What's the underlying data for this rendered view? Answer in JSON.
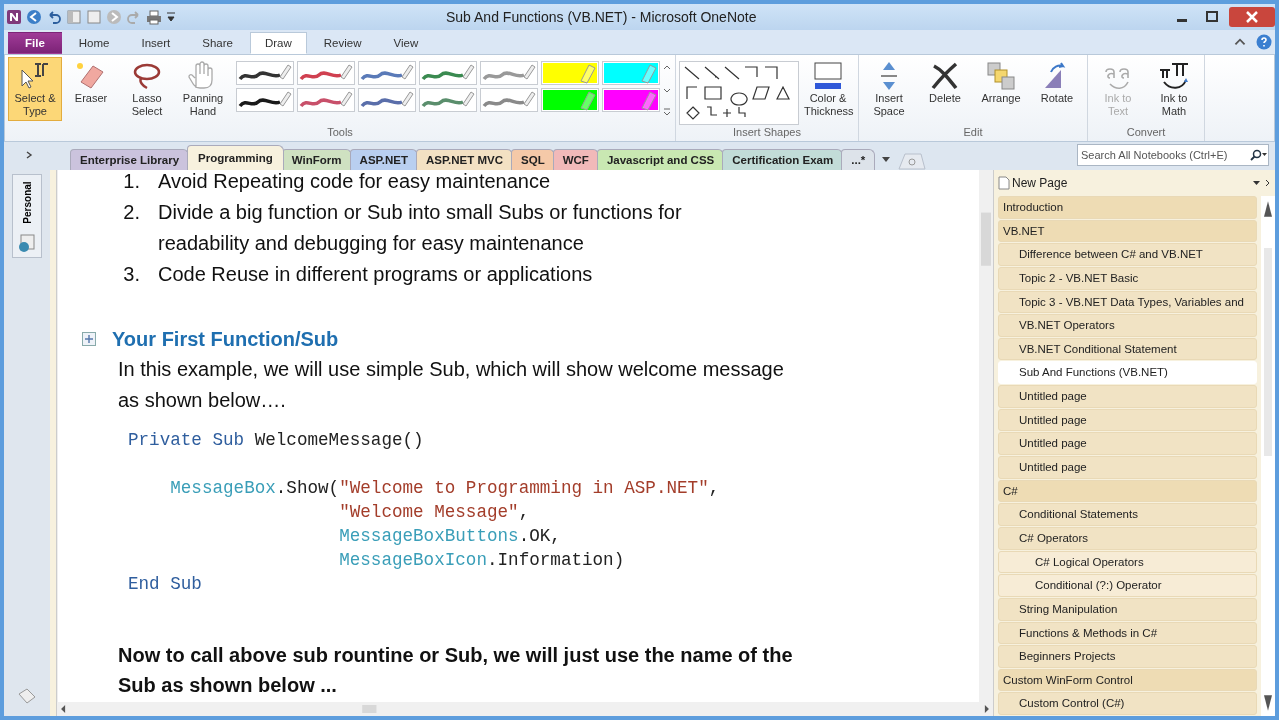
{
  "window": {
    "title": "Sub And Functions (VB.NET) - Microsoft OneNote"
  },
  "ribbon_tabs": [
    {
      "label": "File",
      "selected": false,
      "kind": "file"
    },
    {
      "label": "Home",
      "selected": false,
      "kind": "tab"
    },
    {
      "label": "Insert",
      "selected": false,
      "kind": "tab"
    },
    {
      "label": "Share",
      "selected": false,
      "kind": "tab"
    },
    {
      "label": "Draw",
      "selected": true,
      "kind": "tab"
    },
    {
      "label": "Review",
      "selected": false,
      "kind": "tab"
    },
    {
      "label": "View",
      "selected": false,
      "kind": "tab"
    }
  ],
  "tools_group": {
    "label": "Tools",
    "buttons": [
      {
        "label": "Select & Type",
        "selected": true,
        "kind": "select"
      },
      {
        "label": "Eraser",
        "selected": false,
        "kind": "eraser"
      },
      {
        "label": "Lasso Select",
        "selected": false,
        "kind": "lasso"
      },
      {
        "label": "Panning Hand",
        "selected": false,
        "kind": "hand"
      }
    ],
    "pens": [
      {
        "kind": "pen",
        "color": "#333333"
      },
      {
        "kind": "pen",
        "color": "#d04050"
      },
      {
        "kind": "pen",
        "color": "#5a7ab8"
      },
      {
        "kind": "pen",
        "color": "#3a8a50"
      },
      {
        "kind": "pen",
        "color": "#999999"
      },
      {
        "kind": "highlighter",
        "color": "#ffff00"
      },
      {
        "kind": "highlighter",
        "color": "#00ffff"
      },
      {
        "kind": "pen",
        "color": "#1a1a1a"
      },
      {
        "kind": "pen",
        "color": "#c8506a"
      },
      {
        "kind": "pen",
        "color": "#5a6eaa"
      },
      {
        "kind": "pen",
        "color": "#5a8e6c"
      },
      {
        "kind": "pen",
        "color": "#8a8a8a"
      },
      {
        "kind": "highlighter",
        "color": "#00ff00"
      },
      {
        "kind": "highlighter",
        "color": "#ff00ff"
      }
    ]
  },
  "shapes_group": {
    "label": "Insert Shapes",
    "button": "Color & Thickness"
  },
  "edit_group": {
    "label": "Edit",
    "buttons": [
      {
        "label": "Insert Space",
        "kind": "space"
      },
      {
        "label": "Delete",
        "kind": "delete"
      },
      {
        "label": "Arrange",
        "kind": "arrange"
      },
      {
        "label": "Rotate",
        "kind": "rotate"
      }
    ]
  },
  "convert_group": {
    "label": "Convert",
    "buttons": [
      {
        "label": "Ink to Text",
        "kind": "text",
        "disabled": true
      },
      {
        "label": "Ink to Math",
        "kind": "math",
        "disabled": false
      }
    ]
  },
  "section_tabs": [
    {
      "label": "Enterprise Library",
      "color": "#cbc3dd",
      "selected": false
    },
    {
      "label": "Programming",
      "color": "#f7f1de",
      "selected": true
    },
    {
      "label": "WinForm",
      "color": "#cfe1c1",
      "selected": false
    },
    {
      "label": "ASP.NET",
      "color": "#b9cff0",
      "selected": false
    },
    {
      "label": "ASP.NET MVC",
      "color": "#f3e1c3",
      "selected": false
    },
    {
      "label": "SQL",
      "color": "#f5c9a8",
      "selected": false
    },
    {
      "label": "WCF",
      "color": "#f1b9b9",
      "selected": false
    },
    {
      "label": "Javascript and CSS",
      "color": "#c9e8b2",
      "selected": false
    },
    {
      "label": "Certification Exam",
      "color": "#c2dcd8",
      "selected": false
    },
    {
      "label": "...*",
      "color": "#dde3ea",
      "selected": false
    }
  ],
  "search": {
    "placeholder": "Search All Notebooks (Ctrl+E)"
  },
  "notebook": {
    "label": "Personal"
  },
  "note": {
    "list": [
      {
        "number": "1.",
        "text": "Avoid Repeating code for easy maintenance"
      },
      {
        "number": "2.",
        "text": "Divide a big function or Sub into small Subs or functions for readability and debugging for easy maintenance"
      },
      {
        "number": "3.",
        "text": "Code Reuse in different programs or applications"
      }
    ],
    "heading": "Your First Function/Sub",
    "intro": "In this example, we will use simple Sub, which will show welcome message as shown below….",
    "code": [
      [
        {
          "tokens": [
            {
              "kind": "keyword",
              "text": "Private Sub"
            },
            {
              "kind": "plain",
              "text": " WelcomeMessage()"
            }
          ]
        }
      ],
      [
        {
          "tokens": [
            {
              "kind": "type",
              "text": "    MessageBox"
            },
            {
              "kind": "plain",
              "text": ".Show("
            },
            {
              "kind": "string",
              "text": "\"Welcome to Programming in ASP.NET\""
            },
            {
              "kind": "plain",
              "text": ","
            }
          ]
        },
        {
          "tokens": [
            {
              "kind": "string",
              "text": "                    \"Welcome Message\""
            },
            {
              "kind": "plain",
              "text": ","
            }
          ]
        },
        {
          "tokens": [
            {
              "kind": "type",
              "text": "                    MessageBoxButtons"
            },
            {
              "kind": "plain",
              "text": ".OK,"
            }
          ]
        },
        {
          "tokens": [
            {
              "kind": "type",
              "text": "                    MessageBoxIcon"
            },
            {
              "kind": "plain",
              "text": ".Information)"
            }
          ]
        },
        {
          "tokens": [
            {
              "kind": "keyword",
              "text": "End Sub"
            }
          ]
        }
      ]
    ],
    "closing": "Now to call above sub rountine or Sub, we will just use the name of the Sub as shown below ..."
  },
  "page_list": {
    "new_page": "New Page",
    "pages": [
      {
        "title": "Introduction",
        "selected": false
      },
      {
        "title": "VB.NET",
        "selected": false,
        "children": [
          {
            "title": "Difference between C# and VB.NET",
            "selected": false
          },
          {
            "title": "Topic 2 - VB.NET Basic",
            "selected": false
          },
          {
            "title": "Topic 3 - VB.NET Data Types, Variables and",
            "selected": false
          },
          {
            "title": "VB.NET Operators",
            "selected": false
          },
          {
            "title": "VB.NET Conditional Statement",
            "selected": false
          },
          {
            "title": "Sub And Functions (VB.NET)",
            "selected": true
          },
          {
            "title": "Untitled page",
            "selected": false
          },
          {
            "title": "Untitled page",
            "selected": false
          },
          {
            "title": "Untitled page",
            "selected": false
          },
          {
            "title": "Untitled page",
            "selected": false
          }
        ]
      },
      {
        "title": "C#",
        "selected": false,
        "children": [
          {
            "title": "Conditional Statements",
            "selected": false
          },
          {
            "title": "C# Operators",
            "selected": false,
            "children": [
              {
                "title": "C# Logical Operators",
                "selected": false
              },
              {
                "title": "Conditional (?:) Operator",
                "selected": false
              }
            ]
          },
          {
            "title": "String Manipulation",
            "selected": false
          },
          {
            "title": "Functions & Methods in C#",
            "selected": false
          },
          {
            "title": "Beginners Projects",
            "selected": false
          }
        ]
      },
      {
        "title": "Custom WinForm Control",
        "selected": false,
        "children": [
          {
            "title": "Custom Control (C#)",
            "selected": false
          }
        ]
      }
    ]
  }
}
